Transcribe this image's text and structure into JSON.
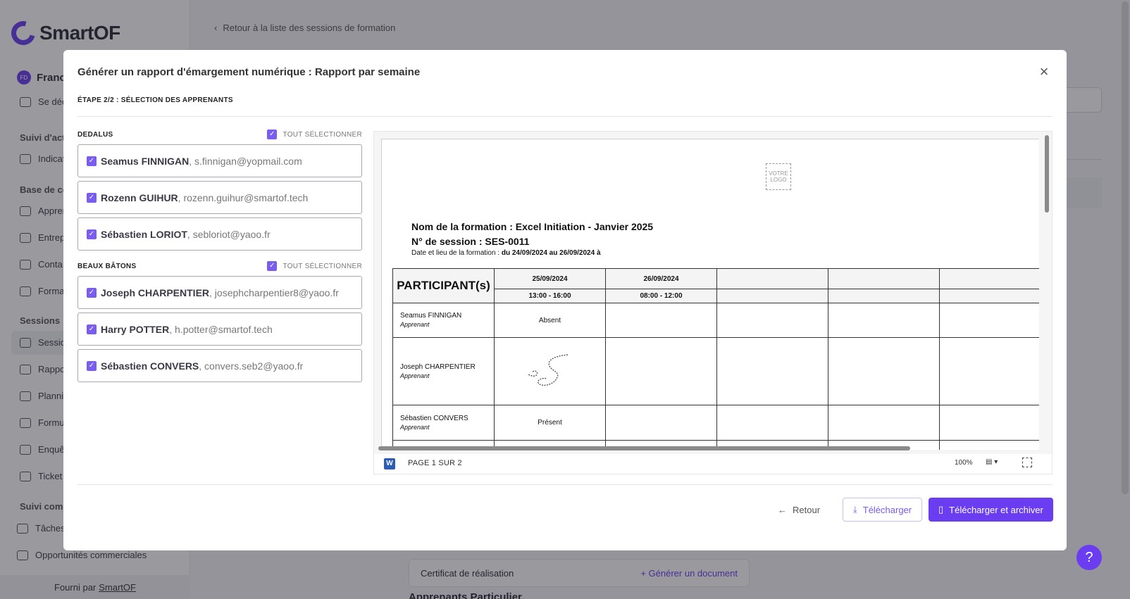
{
  "app": {
    "logo_text": "SmartOF",
    "user_initials": "FD",
    "user_name": "Franc",
    "logout_label": "Se déc",
    "sections": [
      {
        "label": "Suivi d'acti"
      },
      {
        "label": "Base de co"
      },
      {
        "label": "Sessions"
      },
      {
        "label": "Suivi comm"
      }
    ],
    "nav": [
      "Indicat",
      "Appren",
      "Entrep",
      "Conta",
      "Forma",
      "Sessio",
      "Rappo",
      "Plannin",
      "Formu",
      "Enquê",
      "Ticket",
      "Tâches",
      "Opportunités commerciales"
    ],
    "footer_prefix": "Fourni par",
    "footer_link": "SmartOF",
    "back_link": "Retour à la liste des sessions de formation",
    "bg_card_label": "Certificat de réalisation",
    "bg_card_action": "Générer un document",
    "bg_heading": "Apprenants Particulier",
    "help": "?"
  },
  "modal": {
    "title": "Générer un rapport d'émargement numérique : Rapport par semaine",
    "close": "×",
    "step": "ÉTAPE 2/2 : SÉLECTION DES APPRENANTS",
    "select_all_label": "TOUT SÉLECTIONNER",
    "groups": [
      {
        "name": "DEDALUS",
        "learners": [
          {
            "name": "Seamus FINNIGAN",
            "email": ", s.finnigan@yopmail.com"
          },
          {
            "name": "Rozenn GUIHUR",
            "email": ", rozenn.guihur@smartof.tech"
          },
          {
            "name": "Sébastien LORIOT",
            "email": ", sebloriot@yaoo.fr"
          }
        ]
      },
      {
        "name": "BEAUX BÂTONS",
        "learners": [
          {
            "name": "Joseph CHARPENTIER",
            "email": ", josephcharpentier8@yaoo.fr"
          },
          {
            "name": "Harry POTTER",
            "email": ", h.potter@smartof.tech"
          },
          {
            "name": "Sébastien CONVERS",
            "email": ", convers.seb2@yaoo.fr"
          }
        ]
      }
    ],
    "buttons": {
      "back": "Retour",
      "download": "Télécharger",
      "download_archive": "Télécharger et archiver"
    }
  },
  "preview": {
    "logo_placeholder": "VOTRE LOGO",
    "formation": "Nom de la formation : Excel Initiation - Janvier 2025",
    "session": "N° de session : SES-0011",
    "date_prefix": "Date et lieu de la formation :",
    "date_value": "du 24/09/2024 au 26/09/2024 à",
    "table_header": "PARTICIPANT(s)",
    "dates": [
      "25/09/2024",
      "26/09/2024"
    ],
    "times": [
      "13:00 - 16:00",
      "08:00 - 12:00"
    ],
    "role": "Apprenant",
    "rows": [
      {
        "name": "Seamus FINNIGAN",
        "status": "Absent"
      },
      {
        "name": "Joseph CHARPENTIER",
        "status": ""
      },
      {
        "name": "Sébastien CONVERS",
        "status": "Présent"
      }
    ],
    "page_indicator": "PAGE 1 SUR 2",
    "zoom": "100%",
    "word_icon": "W"
  }
}
